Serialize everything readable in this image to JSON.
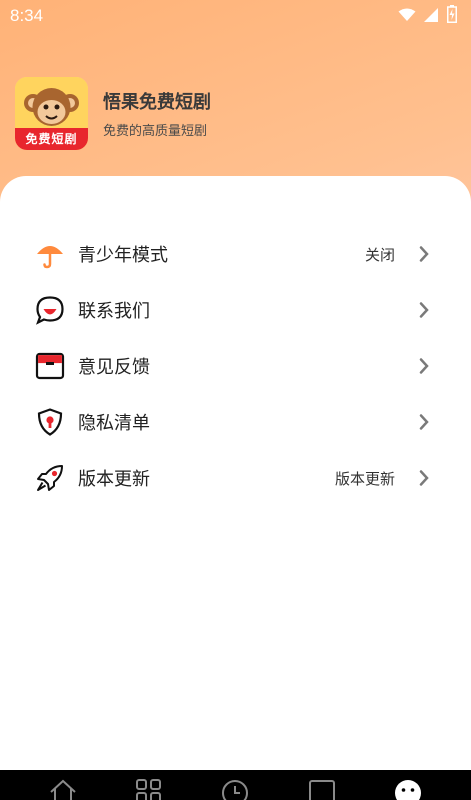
{
  "status_bar": {
    "time": "8:34",
    "icons": [
      "wifi-icon",
      "signal-icon",
      "battery-icon"
    ]
  },
  "app": {
    "title": "悟果免费短剧",
    "subtitle": "免费的高质量短剧",
    "logo_text": "免费短剧"
  },
  "menu": {
    "items": [
      {
        "icon": "umbrella-icon",
        "label": "青少年模式",
        "value": "关闭"
      },
      {
        "icon": "chat-bubble-icon",
        "label": "联系我们",
        "value": ""
      },
      {
        "icon": "feedback-box-icon",
        "label": "意见反馈",
        "value": ""
      },
      {
        "icon": "shield-icon",
        "label": "隐私清单",
        "value": ""
      },
      {
        "icon": "rocket-icon",
        "label": "版本更新",
        "value": "版本更新"
      }
    ]
  },
  "bottom_nav": {
    "tabs": [
      "home-icon",
      "grid-icon",
      "clock-icon",
      "square-icon",
      "profile-icon"
    ]
  },
  "colors": {
    "accent_orange": "#ff8a3d",
    "accent_red": "#e8262d",
    "header_gradient_start": "#ffb277",
    "header_gradient_end": "#ffd7d0"
  }
}
